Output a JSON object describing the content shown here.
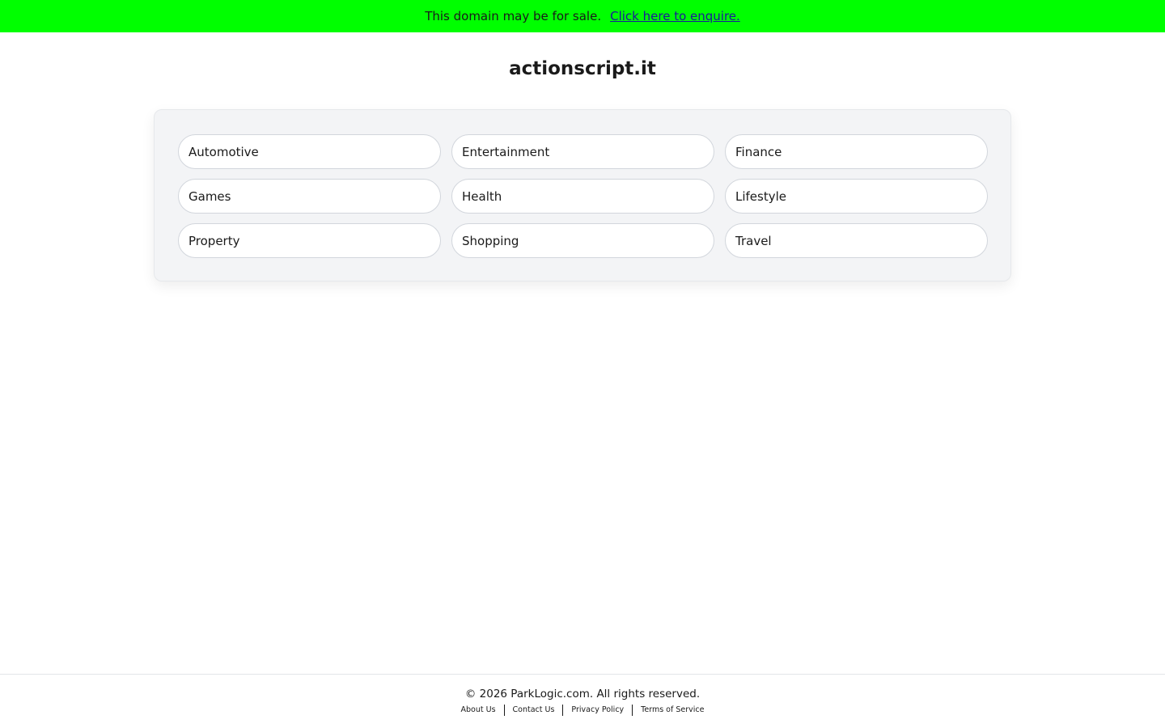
{
  "banner": {
    "text": "This domain may be for sale.",
    "link_label": "Click here to enquire.",
    "background": "#00ff00"
  },
  "domain": {
    "name": "actionscript.it"
  },
  "categories": [
    "Automotive",
    "Entertainment",
    "Finance",
    "Games",
    "Health",
    "Lifestyle",
    "Property",
    "Shopping",
    "Travel"
  ],
  "footer": {
    "copyright": "© 2026 ParkLogic.com. All rights reserved.",
    "links": [
      "About Us",
      "Contact Us",
      "Privacy Policy",
      "Terms of Service"
    ]
  }
}
